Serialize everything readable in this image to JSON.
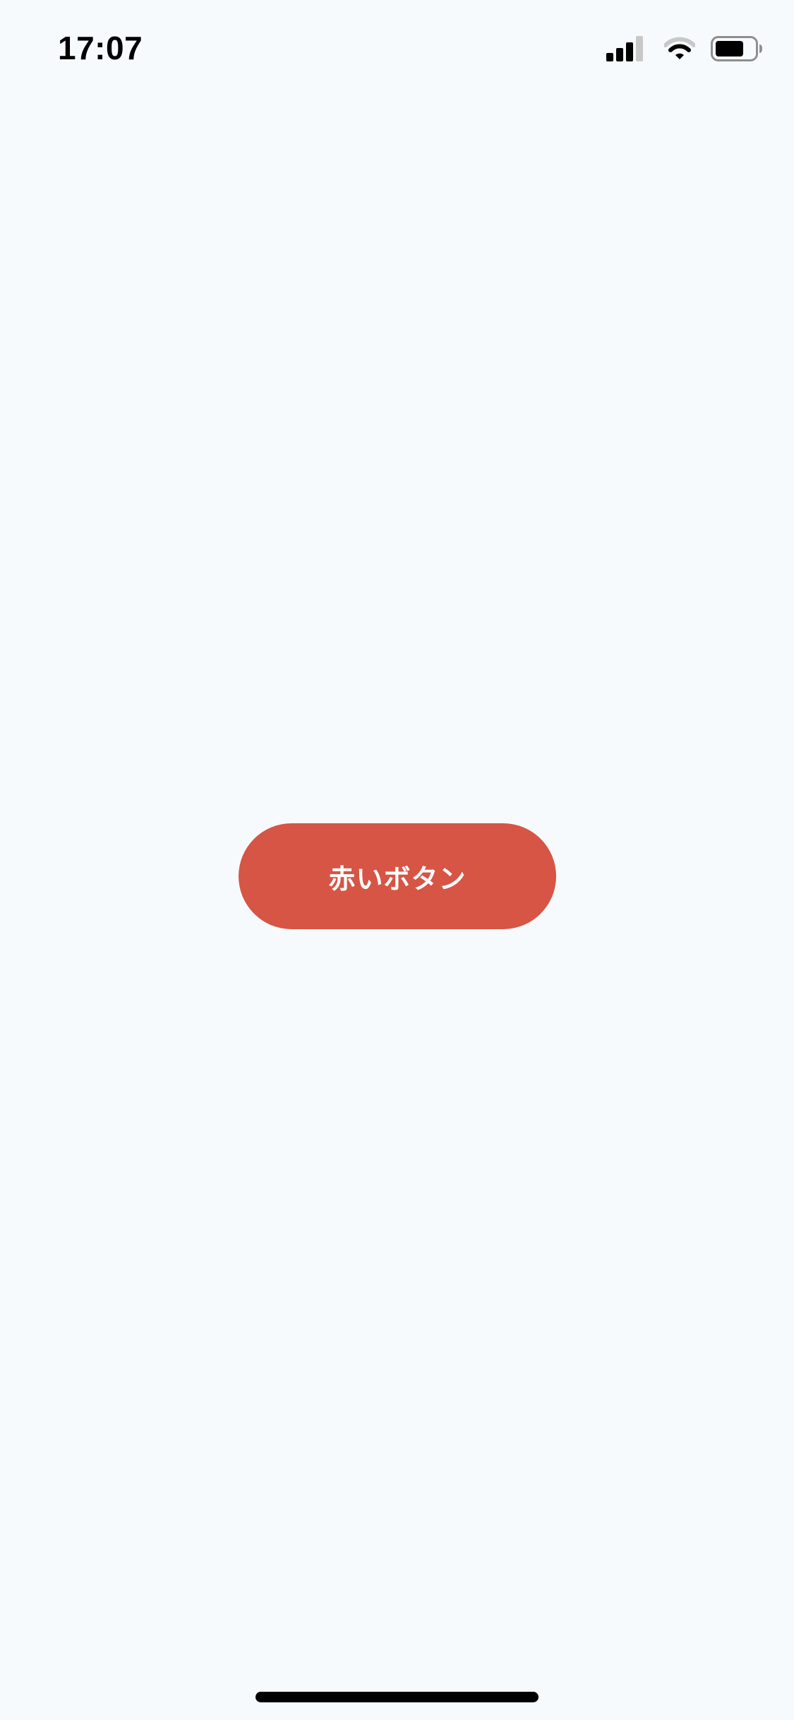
{
  "status_bar": {
    "time": "17:07",
    "icons": [
      "signal-icon",
      "wifi-icon",
      "battery-icon"
    ]
  },
  "main": {
    "button": {
      "label": "赤いボタン",
      "color": "#d65545",
      "text_color": "#ffffff"
    }
  },
  "theme": {
    "background": "#f6fafd"
  }
}
